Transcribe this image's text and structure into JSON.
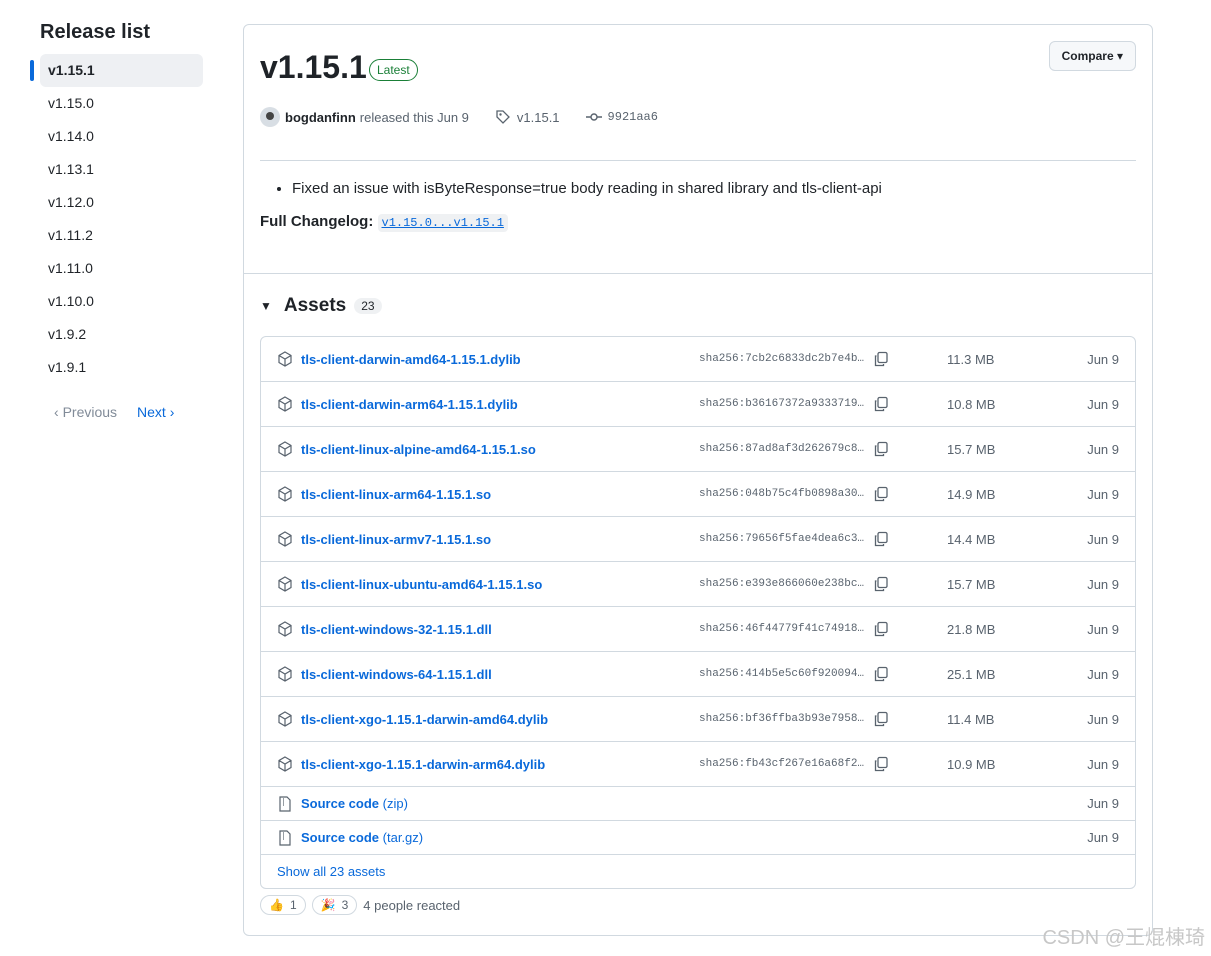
{
  "sidebar": {
    "title": "Release list",
    "items": [
      "v1.15.1",
      "v1.15.0",
      "v1.14.0",
      "v1.13.1",
      "v1.12.0",
      "v1.11.2",
      "v1.11.0",
      "v1.10.0",
      "v1.9.2",
      "v1.9.1"
    ],
    "active_index": 0,
    "prev_label": "Previous",
    "next_label": "Next"
  },
  "release": {
    "title": "v1.15.1",
    "badge": "Latest",
    "compare_label": "Compare",
    "author": "bogdanfinn",
    "released_text": "released this Jun 9",
    "tag": "v1.15.1",
    "commit": "9921aa6",
    "notes": [
      "Fixed an issue with isByteResponse=true body reading in shared library and tls-client-api"
    ],
    "changelog_label": "Full Changelog:",
    "changelog_link": "v1.15.0...v1.15.1"
  },
  "assets": {
    "heading": "Assets",
    "count": "23",
    "rows": [
      {
        "name": "tls-client-darwin-amd64-1.15.1.dylib",
        "sha": "sha256:7cb2c6833dc2b7e4b…",
        "size": "11.3 MB",
        "date": "Jun 9"
      },
      {
        "name": "tls-client-darwin-arm64-1.15.1.dylib",
        "sha": "sha256:b36167372a9333719…",
        "size": "10.8 MB",
        "date": "Jun 9"
      },
      {
        "name": "tls-client-linux-alpine-amd64-1.15.1.so",
        "sha": "sha256:87ad8af3d262679c8…",
        "size": "15.7 MB",
        "date": "Jun 9"
      },
      {
        "name": "tls-client-linux-arm64-1.15.1.so",
        "sha": "sha256:048b75c4fb0898a30…",
        "size": "14.9 MB",
        "date": "Jun 9"
      },
      {
        "name": "tls-client-linux-armv7-1.15.1.so",
        "sha": "sha256:79656f5fae4dea6c3…",
        "size": "14.4 MB",
        "date": "Jun 9"
      },
      {
        "name": "tls-client-linux-ubuntu-amd64-1.15.1.so",
        "sha": "sha256:e393e866060e238bc…",
        "size": "15.7 MB",
        "date": "Jun 9"
      },
      {
        "name": "tls-client-windows-32-1.15.1.dll",
        "sha": "sha256:46f44779f41c74918…",
        "size": "21.8 MB",
        "date": "Jun 9"
      },
      {
        "name": "tls-client-windows-64-1.15.1.dll",
        "sha": "sha256:414b5e5c60f920094…",
        "size": "25.1 MB",
        "date": "Jun 9"
      },
      {
        "name": "tls-client-xgo-1.15.1-darwin-amd64.dylib",
        "sha": "sha256:bf36ffba3b93e7958…",
        "size": "11.4 MB",
        "date": "Jun 9"
      },
      {
        "name": "tls-client-xgo-1.15.1-darwin-arm64.dylib",
        "sha": "sha256:fb43cf267e16a68f2…",
        "size": "10.9 MB",
        "date": "Jun 9"
      }
    ],
    "source": [
      {
        "label": "Source code",
        "suffix": "(zip)",
        "date": "Jun 9"
      },
      {
        "label": "Source code",
        "suffix": "(tar.gz)",
        "date": "Jun 9"
      }
    ],
    "show_all": "Show all 23 assets"
  },
  "reactions": {
    "thumbs_count": "1",
    "party_count": "3",
    "summary": "4 people reacted"
  },
  "watermark": "CSDN @王焜棟琦"
}
